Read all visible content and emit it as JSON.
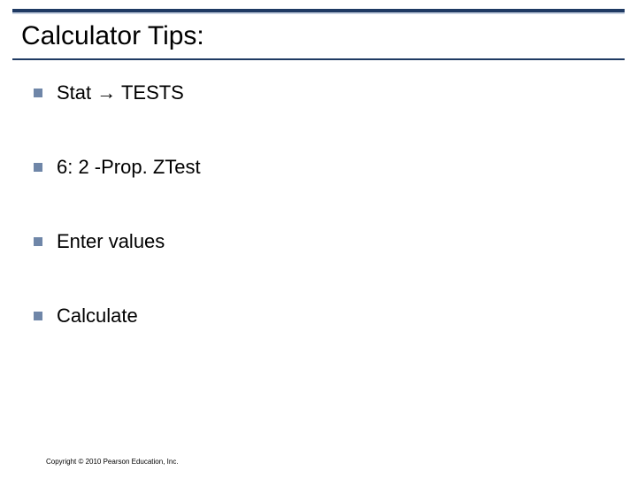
{
  "title": "Calculator Tips:",
  "bullets": [
    "Stat → TESTS",
    "6: 2 -Prop. ZTest",
    "Enter values",
    "Calculate"
  ],
  "copyright": "Copyright © 2010 Pearson Education, Inc."
}
